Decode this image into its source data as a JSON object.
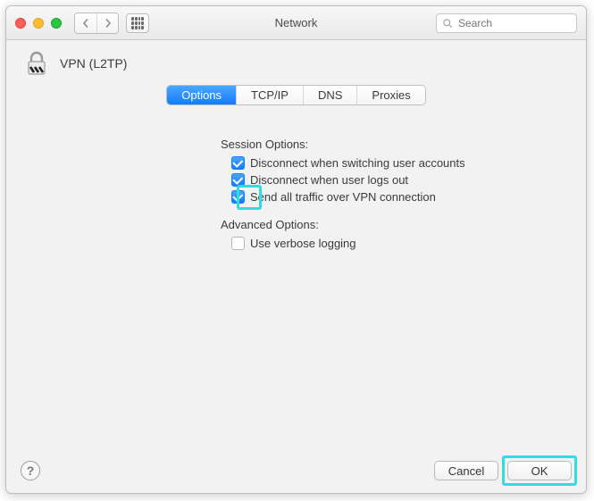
{
  "window": {
    "title": "Network"
  },
  "search": {
    "placeholder": "Search"
  },
  "header": {
    "title": "VPN (L2TP)"
  },
  "tabs": [
    {
      "label": "Options",
      "active": true
    },
    {
      "label": "TCP/IP",
      "active": false
    },
    {
      "label": "DNS",
      "active": false
    },
    {
      "label": "Proxies",
      "active": false
    }
  ],
  "sections": {
    "session": {
      "label": "Session Options:",
      "items": [
        {
          "label": "Disconnect when switching user accounts",
          "checked": true,
          "highlight": false
        },
        {
          "label": "Disconnect when user logs out",
          "checked": true,
          "highlight": false
        },
        {
          "label": "Send all traffic over VPN connection",
          "checked": true,
          "highlight": true
        }
      ]
    },
    "advanced": {
      "label": "Advanced Options:",
      "items": [
        {
          "label": "Use verbose logging",
          "checked": false,
          "highlight": false
        }
      ]
    }
  },
  "footer": {
    "help": "?",
    "cancel": "Cancel",
    "ok": "OK",
    "ok_highlight": true
  }
}
